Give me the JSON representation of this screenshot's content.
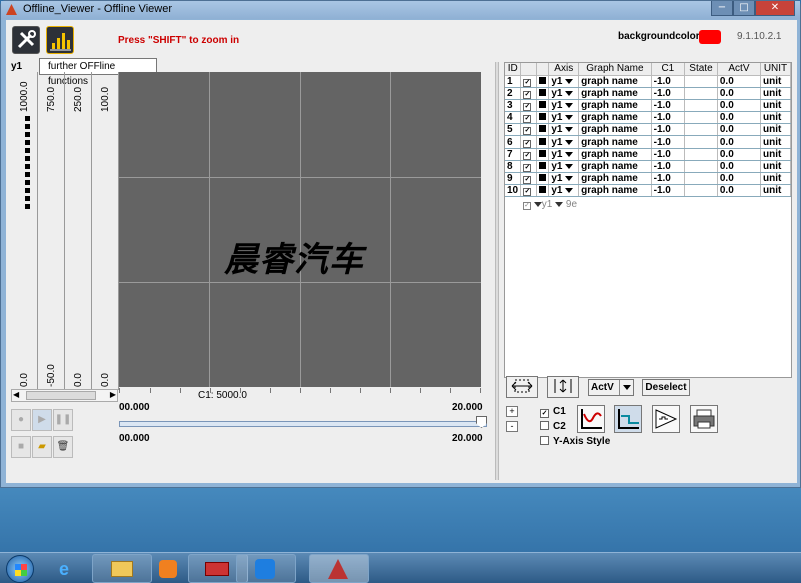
{
  "window": {
    "title": "Offline_Viewer - Offline Viewer",
    "min": "−",
    "max": "□",
    "close": "✕"
  },
  "toolbar": {
    "settings_icon": "wrench-screwdriver-icon",
    "chart_icon": "bar-chart-icon"
  },
  "hint": "Press \"SHIFT\" to zoom in",
  "tooltip": "further OFFline functions",
  "bg_label": "backgroundcolor",
  "bg_color": "#ff0000",
  "version": "9.1.10.2.1",
  "y_axis": {
    "name": "y1",
    "scales": [
      {
        "top": "1000.0",
        "bottom": "0.0"
      },
      {
        "top": "750.0",
        "bottom": "-50.0"
      },
      {
        "top": "250.0",
        "bottom": "0.0"
      },
      {
        "top": "100.0",
        "bottom": "0.0"
      }
    ]
  },
  "watermark": "晨睿汽车",
  "cursor_label": "C1: 5000.0",
  "x_range": {
    "min": "00.000",
    "max": "20.000"
  },
  "slider_range": {
    "min": "00.000",
    "max": "20.000"
  },
  "table": {
    "headers": [
      "ID",
      "",
      "",
      "Axis",
      "Graph Name",
      "C1",
      "State",
      "ActV",
      "UNIT"
    ],
    "rows": [
      {
        "id": "1",
        "axis": "y1",
        "name": "graph name",
        "c1": "-1.0",
        "state": "",
        "actv": "0.0",
        "unit": "unit"
      },
      {
        "id": "2",
        "axis": "y1",
        "name": "graph name",
        "c1": "-1.0",
        "state": "",
        "actv": "0.0",
        "unit": "unit"
      },
      {
        "id": "3",
        "axis": "y1",
        "name": "graph name",
        "c1": "-1.0",
        "state": "",
        "actv": "0.0",
        "unit": "unit"
      },
      {
        "id": "4",
        "axis": "y1",
        "name": "graph name",
        "c1": "-1.0",
        "state": "",
        "actv": "0.0",
        "unit": "unit"
      },
      {
        "id": "5",
        "axis": "y1",
        "name": "graph name",
        "c1": "-1.0",
        "state": "",
        "actv": "0.0",
        "unit": "unit"
      },
      {
        "id": "6",
        "axis": "y1",
        "name": "graph name",
        "c1": "-1.0",
        "state": "",
        "actv": "0.0",
        "unit": "unit"
      },
      {
        "id": "7",
        "axis": "y1",
        "name": "graph name",
        "c1": "-1.0",
        "state": "",
        "actv": "0.0",
        "unit": "unit"
      },
      {
        "id": "8",
        "axis": "y1",
        "name": "graph name",
        "c1": "-1.0",
        "state": "",
        "actv": "0.0",
        "unit": "unit"
      },
      {
        "id": "9",
        "axis": "y1",
        "name": "graph name",
        "c1": "-1.0",
        "state": "",
        "actv": "0.0",
        "unit": "unit"
      },
      {
        "id": "10",
        "axis": "y1",
        "name": "graph name",
        "c1": "-1.0",
        "state": "",
        "actv": "0.0",
        "unit": "unit"
      }
    ],
    "ghost_axis": "y1",
    "ghost_name": "9e"
  },
  "controls": {
    "actv_select": "ActV",
    "deselect": "Deselect",
    "plus": "+",
    "minus": "-",
    "c1": "C1",
    "c2": "C2",
    "y_axis_style": "Y-Axis Style",
    "c1_checked": true,
    "c2_checked": false,
    "yaxis_checked": false
  }
}
